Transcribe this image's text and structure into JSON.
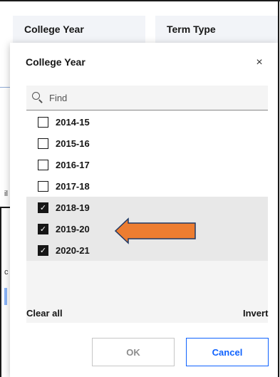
{
  "filter_bar": {
    "college_year_label": "College Year",
    "term_type_label": "Term Type"
  },
  "background_marks": [
    "il",
    "c"
  ],
  "dialog": {
    "title": "College Year",
    "close_glyph": "×",
    "search": {
      "placeholder": "Find",
      "value": ""
    },
    "items": [
      {
        "label": "2014-15",
        "checked": false
      },
      {
        "label": "2015-16",
        "checked": false
      },
      {
        "label": "2016-17",
        "checked": false
      },
      {
        "label": "2017-18",
        "checked": false
      },
      {
        "label": "2018-19",
        "checked": true
      },
      {
        "label": "2019-20",
        "checked": true
      },
      {
        "label": "2020-21",
        "checked": true
      }
    ],
    "clear_all_label": "Clear all",
    "invert_label": "Invert",
    "ok_label": "OK",
    "cancel_label": "Cancel"
  },
  "annotation": {
    "arrow_color": "#ed7d31",
    "arrow_border": "#1f3864",
    "points_to": "2019-20"
  },
  "colors": {
    "accent": "#0f62fe",
    "checkbox": "#161616",
    "selected_row": "#e8e8e8"
  }
}
